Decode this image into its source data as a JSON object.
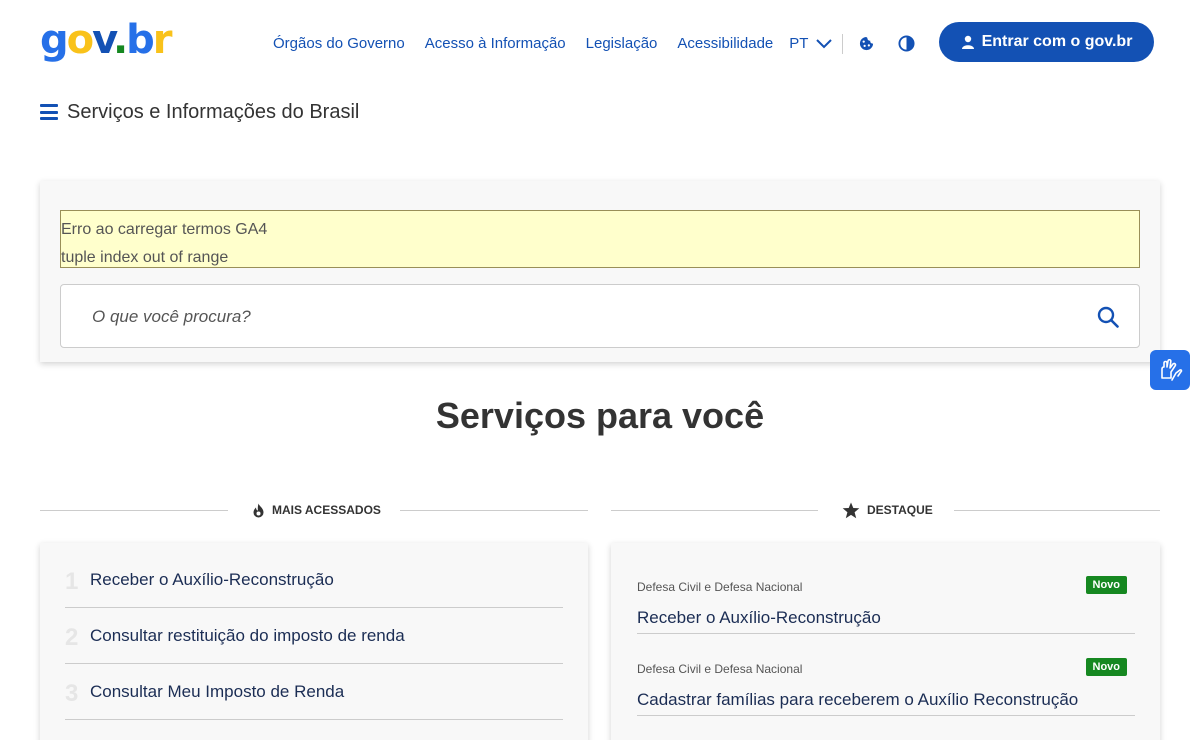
{
  "header": {
    "logo_text": "gov.br",
    "nav": [
      "Órgãos do Governo",
      "Acesso à Informação",
      "Legislação",
      "Acessibilidade"
    ],
    "language": "PT",
    "login_label_prefix": "Entrar com o ",
    "login_label_brand": "gov.br",
    "brand_color": "#1351b4"
  },
  "menu": {
    "title": "Serviços e Informações do Brasil"
  },
  "search": {
    "error_line1": "Erro ao carregar termos GA4",
    "error_line2": "tuple index out of range",
    "placeholder": "O que você procura?"
  },
  "services": {
    "heading": "Serviços para você",
    "most_accessed": {
      "label": "Mais acessados",
      "items": [
        {
          "rank": "1",
          "text": "Receber o Auxílio-Reconstrução"
        },
        {
          "rank": "2",
          "text": "Consultar restituição do imposto de renda"
        },
        {
          "rank": "3",
          "text": "Consultar Meu Imposto de Renda"
        }
      ]
    },
    "highlights": {
      "label": "Destaque",
      "items": [
        {
          "category": "Defesa Civil e Defesa Nacional",
          "title": "Receber o Auxílio-Reconstrução",
          "badge": "Novo"
        },
        {
          "category": "Defesa Civil e Defesa Nacional",
          "title": "Cadastrar famílias para receberem o Auxílio Reconstrução",
          "badge": "Novo"
        }
      ]
    }
  },
  "icons": {
    "menu": "hamburger-icon",
    "search": "search-icon",
    "cookie": "cookie-icon",
    "contrast": "contrast-icon",
    "user": "user-icon",
    "vlibras": "sign-language-icon",
    "fire": "fire-icon",
    "star": "star-icon"
  }
}
